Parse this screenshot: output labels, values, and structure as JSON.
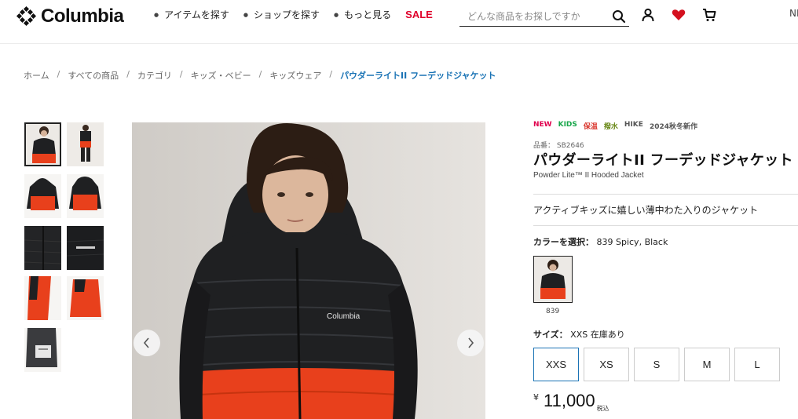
{
  "header": {
    "brand": "Columbia",
    "nav": [
      {
        "label": "アイテムを探す"
      },
      {
        "label": "ショップを探す"
      },
      {
        "label": "もっと見る"
      }
    ],
    "sale_label": "SALE",
    "search_placeholder": "どんな商品をお探しですか",
    "cut_text": "NE"
  },
  "breadcrumb": [
    "ホーム",
    "すべての商品",
    "カテゴリ",
    "キッズ・ベビー",
    "キッズウェア",
    "パウダーライトII フーデッドジャケット"
  ],
  "breadcrumb_sep": "/",
  "tags": [
    {
      "label": "NEW",
      "color": "#e0004d"
    },
    {
      "label": "KIDS",
      "color": "#18a64a"
    },
    {
      "label": "保温",
      "color": "#d9342b"
    },
    {
      "label": "撥水",
      "color": "#6b8a1a"
    },
    {
      "label": "HIKE",
      "color": "#555555"
    },
    {
      "label": "2024秋冬新作",
      "color": "#555555"
    }
  ],
  "product": {
    "number": "品番： SB2646",
    "title": "パウダーライトII フーデッドジャケット",
    "subtitle": "Powder Lite™ II Hooded Jacket",
    "catch": "アクティブキッズに嬉しい薄中わた入りのジャケット",
    "color_label": "カラーを選択：",
    "color_value": "839 Spicy, Black",
    "swatch_code": "839",
    "size_label": "サイズ：",
    "size_value": "XXS  在庫あり",
    "sizes": [
      "XXS",
      "XS",
      "S",
      "M",
      "L"
    ],
    "selected_size": "XXS",
    "price_currency": "¥",
    "price": "11,000",
    "price_tax": "税込"
  },
  "colors": {
    "accent": "#1a73b5",
    "sale": "#e0002a",
    "jacket_orange": "#e8401c",
    "jacket_black": "#1f2022"
  },
  "main_image_logo": "Columbia"
}
